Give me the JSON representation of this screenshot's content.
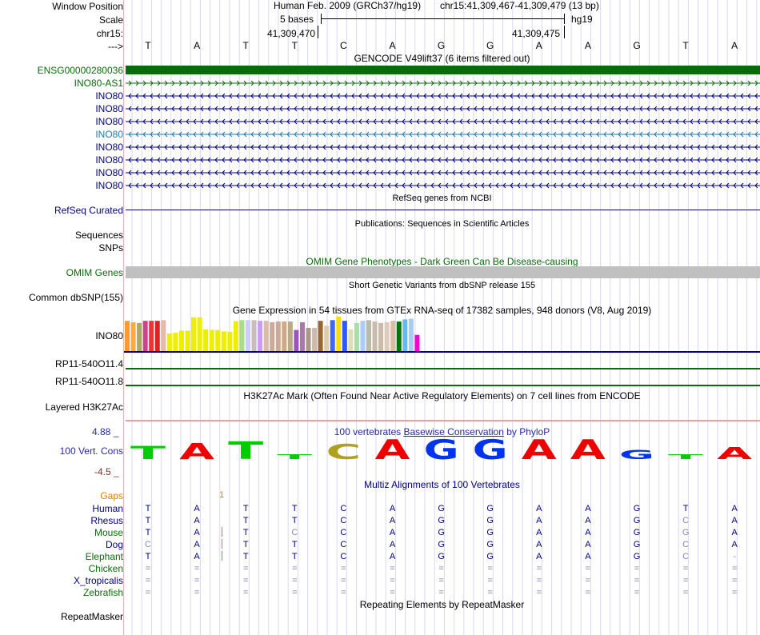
{
  "header": {
    "window_position_label": "Window Position",
    "assembly": "Human Feb. 2009 (GRCh37/hg19)",
    "position": "chr15:41,309,467-41,309,479 (13 bp)",
    "scale_label": "Scale",
    "scale_text": "5 bases",
    "scale_db": "hg19",
    "chrom_label": "chr15:",
    "coord_left": "41,309,470",
    "coord_right": "41,309,475",
    "arrow_label": "--->"
  },
  "bases": [
    "T",
    "A",
    "T",
    "T",
    "C",
    "A",
    "G",
    "G",
    "A",
    "A",
    "G",
    "T",
    "A"
  ],
  "gencode": {
    "title": "GENCODE V49lift37 (6 items filtered out)",
    "genes": [
      {
        "name": "ENSG00000280036",
        "color": "#0a6b0a",
        "style": "solid"
      },
      {
        "name": "INO80-AS1",
        "color": "#0a6b0a",
        "style": "forward"
      },
      {
        "name": "INO80",
        "color": "#000080",
        "style": "reverse"
      },
      {
        "name": "INO80",
        "color": "#000080",
        "style": "reverse"
      },
      {
        "name": "INO80",
        "color": "#000080",
        "style": "reverse"
      },
      {
        "name": "INO80",
        "color": "#1f77b4",
        "style": "reverse"
      },
      {
        "name": "INO80",
        "color": "#000080",
        "style": "reverse"
      },
      {
        "name": "INO80",
        "color": "#000080",
        "style": "reverse"
      },
      {
        "name": "INO80",
        "color": "#000080",
        "style": "reverse"
      },
      {
        "name": "INO80",
        "color": "#000080",
        "style": "reverse"
      }
    ]
  },
  "refseq": {
    "title": "RefSeq genes from NCBI",
    "label": "RefSeq Curated"
  },
  "publications": {
    "title": "Publications: Sequences in Scientific Articles",
    "label1": "Sequences",
    "label2": "SNPs"
  },
  "omim": {
    "title": "OMIM Gene Phenotypes - Dark Green Can Be Disease-causing",
    "label": "OMIM Genes"
  },
  "dbsnp": {
    "title": "Short Genetic Variants from dbSNP release 155",
    "label": "Common dbSNP(155)"
  },
  "gtex": {
    "title": "Gene Expression in 54 tissues from GTEx RNA-seq of 17382 samples, 948 donors (V8, Aug 2019)",
    "label": "INO80",
    "bars": [
      {
        "h": 0.86,
        "c": "#ff9933"
      },
      {
        "h": 0.82,
        "c": "#ffaa44"
      },
      {
        "h": 0.8,
        "c": "#aaaa66"
      },
      {
        "h": 0.86,
        "c": "#cc4488"
      },
      {
        "h": 0.86,
        "c": "#ee3333"
      },
      {
        "h": 0.86,
        "c": "#dd2222"
      },
      {
        "h": 0.88,
        "c": "#e8b8a8"
      },
      {
        "h": 0.5,
        "c": "#eeee00"
      },
      {
        "h": 0.52,
        "c": "#eeee00"
      },
      {
        "h": 0.58,
        "c": "#eeee00"
      },
      {
        "h": 0.58,
        "c": "#eeee00"
      },
      {
        "h": 0.96,
        "c": "#eeee00"
      },
      {
        "h": 0.96,
        "c": "#eeee00"
      },
      {
        "h": 0.62,
        "c": "#eeee00"
      },
      {
        "h": 0.6,
        "c": "#eeee00"
      },
      {
        "h": 0.6,
        "c": "#eeee00"
      },
      {
        "h": 0.56,
        "c": "#eeee00"
      },
      {
        "h": 0.55,
        "c": "#eeee00"
      },
      {
        "h": 0.85,
        "c": "#eeee00"
      },
      {
        "h": 0.88,
        "c": "#aadd88"
      },
      {
        "h": 0.88,
        "c": "#ccccff"
      },
      {
        "h": 0.88,
        "c": "#ccbbbb"
      },
      {
        "h": 0.86,
        "c": "#cc99ff"
      },
      {
        "h": 0.86,
        "c": "#ddbbaa"
      },
      {
        "h": 0.82,
        "c": "#ccaa99"
      },
      {
        "h": 0.84,
        "c": "#ccaa99"
      },
      {
        "h": 0.84,
        "c": "#ccaa88"
      },
      {
        "h": 0.84,
        "c": "#bbaa88"
      },
      {
        "h": 0.6,
        "c": "#9955bb"
      },
      {
        "h": 0.82,
        "c": "#aa77aa"
      },
      {
        "h": 0.66,
        "c": "#aa9988"
      },
      {
        "h": 0.66,
        "c": "#ccbbaa"
      },
      {
        "h": 0.86,
        "c": "#996633"
      },
      {
        "h": 0.72,
        "c": "#ddccaa"
      },
      {
        "h": 0.88,
        "c": "#4466ff"
      },
      {
        "h": 0.98,
        "c": "#ffdd00"
      },
      {
        "h": 0.86,
        "c": "#3355ff"
      },
      {
        "h": 0.62,
        "c": "#ddddbb"
      },
      {
        "h": 0.8,
        "c": "#aaddaa"
      },
      {
        "h": 0.86,
        "c": "#aaccff"
      },
      {
        "h": 0.88,
        "c": "#bbbbaa"
      },
      {
        "h": 0.84,
        "c": "#ccbbaa"
      },
      {
        "h": 0.8,
        "c": "#ccbbaa"
      },
      {
        "h": 0.82,
        "c": "#ddccbb"
      },
      {
        "h": 0.86,
        "c": "#ddbbaa"
      },
      {
        "h": 0.84,
        "c": "#007700"
      },
      {
        "h": 0.9,
        "c": "#66bbee"
      },
      {
        "h": 0.92,
        "c": "#aaccee"
      },
      {
        "h": 0.46,
        "c": "#ff00cc"
      }
    ]
  },
  "rp11": {
    "label1": "RP11-540O11.4",
    "label2": "RP11-540O11.8"
  },
  "h3k27ac": {
    "title": "H3K27Ac Mark (Often Found Near Active Regulatory Elements) on 7 cell lines from ENCODE",
    "label": "Layered H3K27Ac"
  },
  "cons": {
    "title_pre": "100 vertebrates ",
    "title_link": "Basewise Conservation",
    "title_post": " by PhyloP",
    "label": "100 Vert. Cons",
    "ymax": "4.88 _",
    "ymin": "-4.5 _",
    "logo_colors": {
      "T": "#00cc00",
      "A": "#ee0000",
      "C": "#b0a020",
      "G": "#0033ee"
    }
  },
  "multiz": {
    "title": "Multiz Alignments of 100 Vertebrates",
    "gaps_label": "Gaps",
    "gap_count": "1",
    "species": [
      {
        "name": "Human",
        "color": "#000080",
        "seq": [
          "T",
          "A",
          "T",
          "T",
          "C",
          "A",
          "G",
          "G",
          "A",
          "A",
          "G",
          "T",
          "A"
        ]
      },
      {
        "name": "Rhesus",
        "color": "#000080",
        "seq": [
          "T",
          "A",
          "T",
          "T",
          "C",
          "A",
          "G",
          "G",
          "A",
          "A",
          "G",
          "C",
          "A"
        ]
      },
      {
        "name": "Mouse",
        "color": "#0a6b0a",
        "seq": [
          "T",
          "A",
          "T",
          "C",
          "C",
          "A",
          "G",
          "G",
          "A",
          "A",
          "G",
          "G",
          "A"
        ]
      },
      {
        "name": "Dog",
        "color": "#000080",
        "seq": [
          "C",
          "A",
          "T",
          "T",
          "C",
          "A",
          "G",
          "G",
          "A",
          "A",
          "G",
          "C",
          "A"
        ]
      },
      {
        "name": "Elephant",
        "color": "#0a6b0a",
        "seq": [
          "T",
          "A",
          "T",
          "T",
          "C",
          "A",
          "G",
          "G",
          "A",
          "A",
          "G",
          "C",
          "-"
        ]
      },
      {
        "name": "Chicken",
        "color": "#0a6b0a",
        "seq": [
          "=",
          "=",
          "=",
          "=",
          "=",
          "=",
          "=",
          "=",
          "=",
          "=",
          "=",
          "=",
          "="
        ]
      },
      {
        "name": "X_tropicalis",
        "color": "#000080",
        "seq": [
          "=",
          "=",
          "=",
          "=",
          "=",
          "=",
          "=",
          "=",
          "=",
          "=",
          "=",
          "=",
          "="
        ]
      },
      {
        "name": "Zebrafish",
        "color": "#0a6b0a",
        "seq": [
          "=",
          "=",
          "=",
          "=",
          "=",
          "=",
          "=",
          "=",
          "=",
          "=",
          "=",
          "=",
          "="
        ]
      }
    ]
  },
  "repeatmasker": {
    "title": "Repeating Elements by RepeatMasker",
    "label": "RepeatMasker"
  }
}
